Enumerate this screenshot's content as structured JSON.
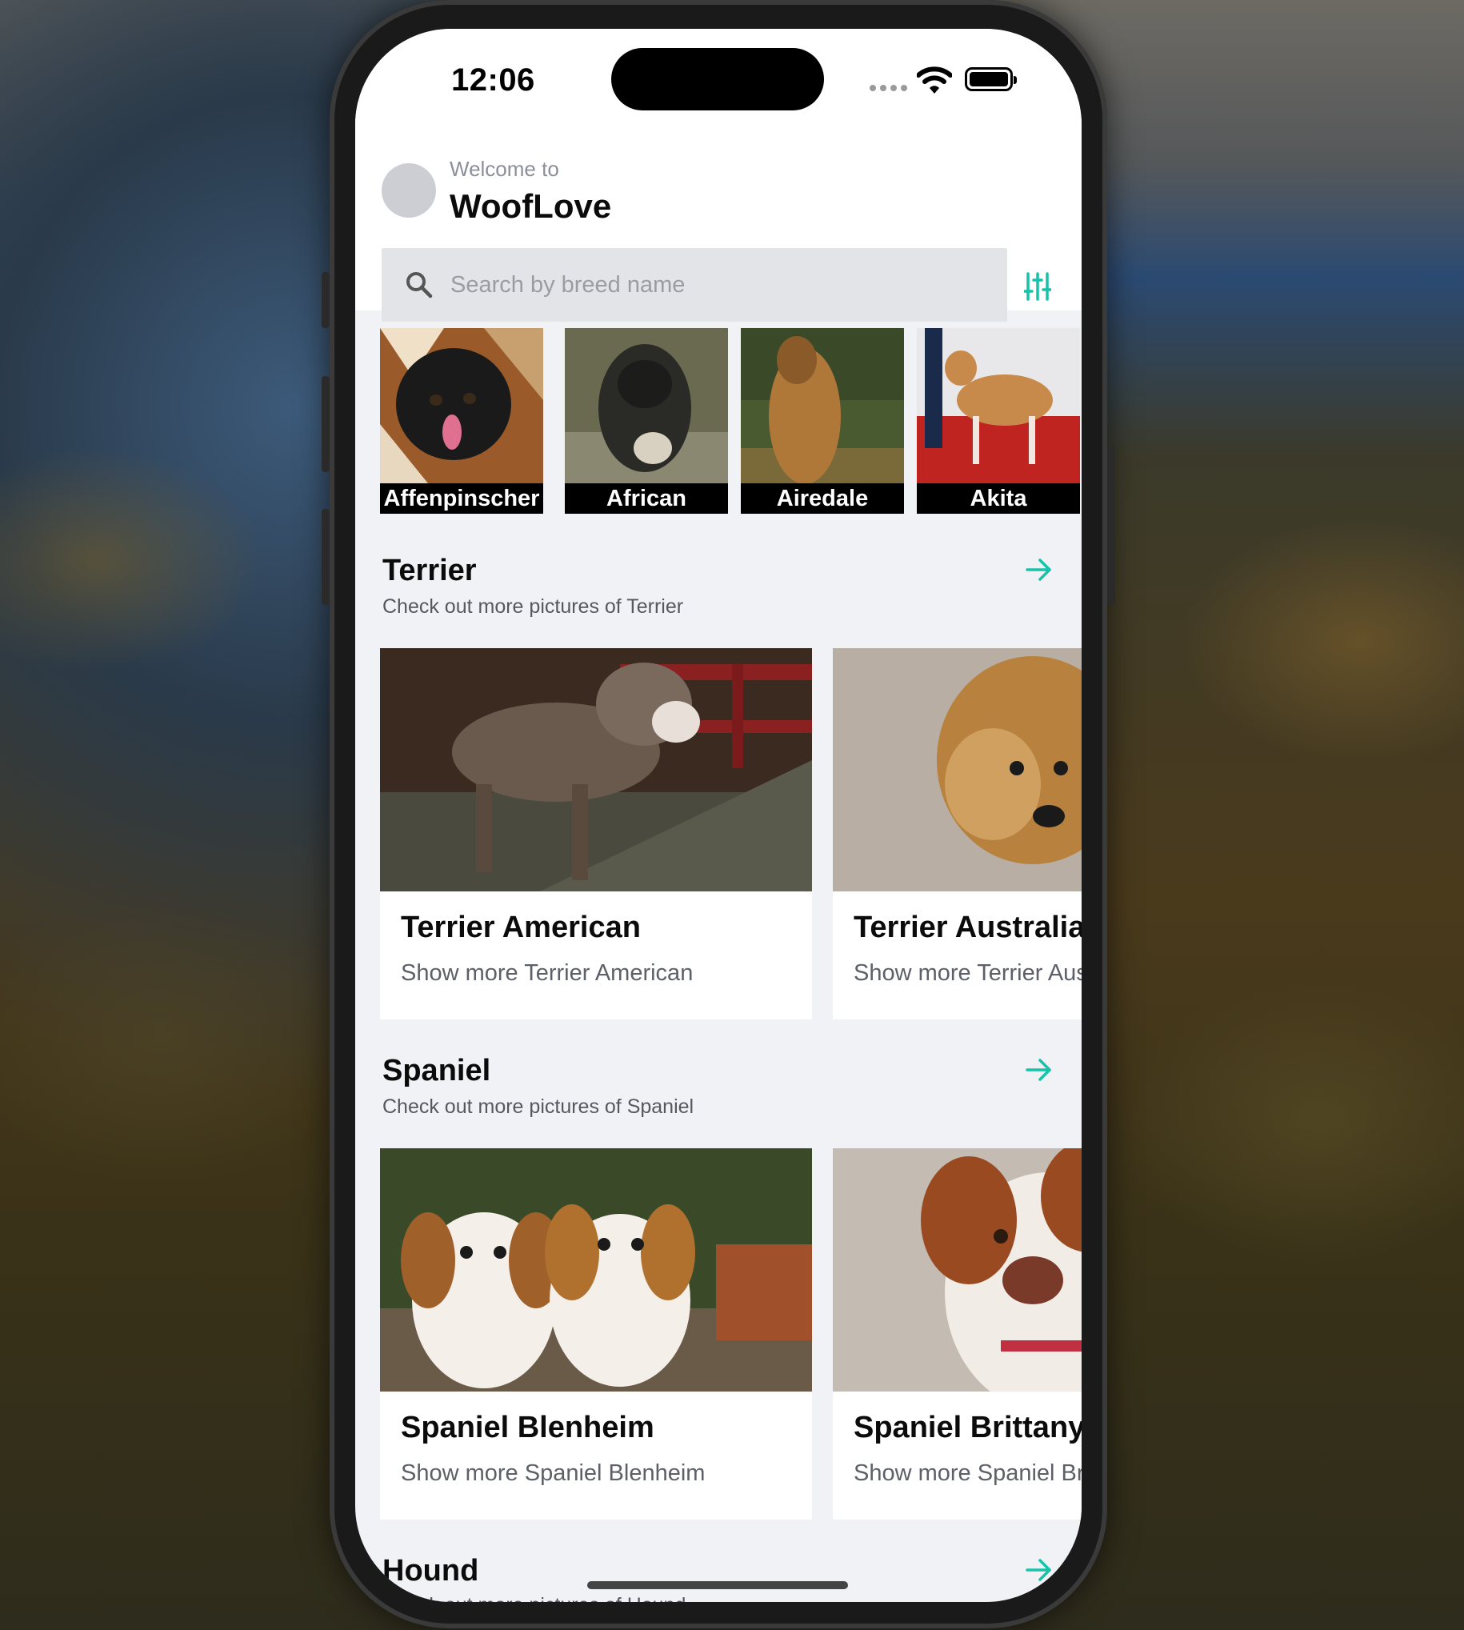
{
  "status_bar": {
    "time": "12:06"
  },
  "header": {
    "welcome": "Welcome to",
    "app_name": "WoofLove"
  },
  "search": {
    "placeholder": "Search by breed name"
  },
  "breeds": [
    {
      "label": "Affenpinscher"
    },
    {
      "label": "African"
    },
    {
      "label": "Airedale"
    },
    {
      "label": "Akita"
    }
  ],
  "sections": [
    {
      "title": "Terrier",
      "subtitle": "Check out more pictures of Terrier",
      "cards": [
        {
          "title": "Terrier American",
          "subtitle": "Show more Terrier American"
        },
        {
          "title": "Terrier Australian",
          "subtitle": "Show more Terrier Australian"
        }
      ]
    },
    {
      "title": "Spaniel",
      "subtitle": "Check out more pictures of Spaniel",
      "cards": [
        {
          "title": "Spaniel Blenheim",
          "subtitle": "Show more Spaniel Blenheim"
        },
        {
          "title": "Spaniel Brittany",
          "subtitle": "Show more Spaniel Brittany"
        }
      ]
    },
    {
      "title": "Hound",
      "subtitle": "Check out more pictures of Hound"
    }
  ],
  "icons": {
    "search": "search-icon",
    "filter": "sliders-icon",
    "arrow": "arrow-right-icon",
    "wifi": "wifi-icon",
    "battery": "battery-icon"
  },
  "colors": {
    "accent": "#16c2a8",
    "background": "#f1f2f6",
    "label_bg": "#000000"
  }
}
